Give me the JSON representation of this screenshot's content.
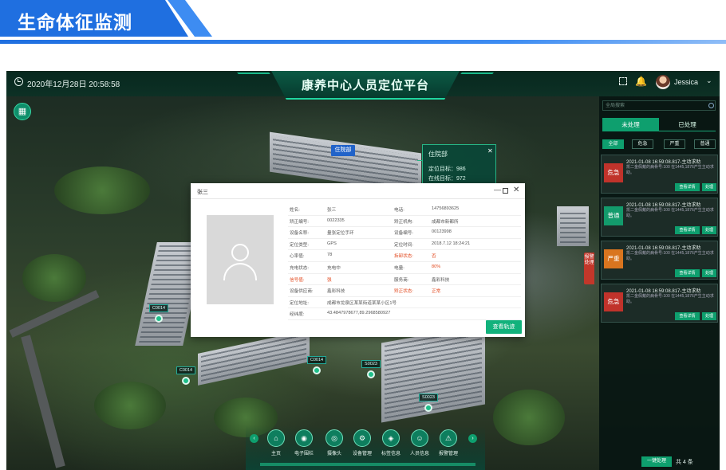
{
  "header": {
    "title": "生命体征监测"
  },
  "topbar": {
    "datetime": "2020年12月28日  20:58:58",
    "platform_title": "康养中心人员定位平台",
    "username": "Jessica"
  },
  "map": {
    "building_tag": "住院部",
    "popup": {
      "title": "住院部",
      "line1": "定位目标：986",
      "line2": "在线目标：972"
    },
    "markers": [
      "C0014",
      "C0014",
      "C0014",
      "S0023",
      "S0023"
    ]
  },
  "dialog": {
    "title": "张三",
    "rows": [
      {
        "k1": "姓名:",
        "v1": "张三",
        "k2": "电话:",
        "v2": "14756893625"
      },
      {
        "k1": "矫正编号:",
        "v1": "0022335",
        "k2": "矫正机构:",
        "v2": "成都市新都所"
      },
      {
        "k1": "设备名称:",
        "v1": "量张定位手环",
        "k2": "设备编号:",
        "v2": "00123998"
      },
      {
        "k1": "定位类型:",
        "v1": "GPS",
        "k2": "定位时间:",
        "v2": "2018.7.12 18:24:21"
      },
      {
        "k1": "心率值:",
        "v1": "78",
        "k2": "拆卸状态:",
        "v2": "否"
      },
      {
        "k1": "充电状态:",
        "v1": "充电中",
        "k2": "电量:",
        "v2": "80%"
      },
      {
        "k1": "信号值:",
        "v1": "强",
        "k2": "服务商:",
        "v2": "鑫彩科技"
      },
      {
        "k1": "设备供应商:",
        "v1": "鑫彩科技",
        "k2": "矫正状态:",
        "v2": "正常"
      },
      {
        "k1": "定位地址:",
        "v1": "成都市龙泉区某某街道某某小区1号",
        "k2": "",
        "v2": ""
      },
      {
        "k1": "经纬度:",
        "v1": "43.4847978677,89.2968580927",
        "k2": "",
        "v2": ""
      }
    ],
    "track_button": "查看轨迹"
  },
  "panel": {
    "search_placeholder": "全局搜索",
    "tab_pending": "未处理",
    "tab_done": "已处理",
    "filters": [
      "全部",
      "危急",
      "严重",
      "普通"
    ],
    "side_tab": "报警处理",
    "alerts": [
      {
        "level": "危急",
        "color": "#c0332b",
        "time": "2021-01-08 16:59:08.817-主动求助",
        "message": "凯二金佩戴的病骨号:100 在1445,1876产生主动求助。",
        "detail": "查看详情",
        "handle": "处理"
      },
      {
        "level": "普通",
        "color": "#139b6c",
        "time": "2021-01-08 16:59:08.817-主动求助",
        "message": "凯二金佩戴的病骨号:100 在1445,1876产生主动求助。",
        "detail": "查看详情",
        "handle": "处理"
      },
      {
        "level": "严重",
        "color": "#d9751f",
        "time": "2021-01-08 16:59:08.817-主动求助",
        "message": "凯二金佩戴的病骨号:100 在1445,1876产生主动求助。",
        "detail": "查看详情",
        "handle": "处理"
      },
      {
        "level": "危急",
        "color": "#c0332b",
        "time": "2021-01-08 16:59:08.817-主动求助",
        "message": "凯二金佩戴的病骨号:100 在1445,1876产生主动求助。",
        "detail": "查看详情",
        "handle": "处理"
      }
    ],
    "oneclick": "一键处理",
    "total": "共 4 条"
  },
  "dock": {
    "items": [
      {
        "label": "主页",
        "icon": "home-icon",
        "glyph": "⌂"
      },
      {
        "label": "电子围栏",
        "icon": "fence-icon",
        "glyph": "◉"
      },
      {
        "label": "摄像头",
        "icon": "camera-icon",
        "glyph": "◎"
      },
      {
        "label": "设备管理",
        "icon": "gear-icon",
        "glyph": "⚙"
      },
      {
        "label": "标签信息",
        "icon": "tag-icon",
        "glyph": "◈"
      },
      {
        "label": "人员信息",
        "icon": "users-icon",
        "glyph": "☺"
      },
      {
        "label": "报警管理",
        "icon": "alarm-icon",
        "glyph": "⚠"
      }
    ]
  }
}
